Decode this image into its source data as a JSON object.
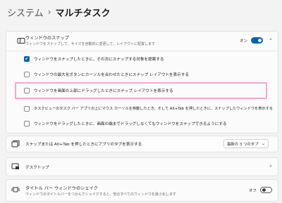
{
  "breadcrumb": {
    "root": "システム",
    "separator": "›",
    "current": "マルチタスク"
  },
  "snap": {
    "title": "ウィンドウのスナップ",
    "subtitle": "ウィンドウをスナップして、サイズを自動的に変更して、レイアウトに配置します",
    "toggle_state": "オン",
    "toggle_on": true,
    "options": [
      {
        "label": "ウィンドウをスナップしたときに、その次にスナップする対象を提案する",
        "checked": true
      },
      {
        "label": "ウィンドウの最大化ボタンにカーソルを合わせたときにスナップ レイアウトを表示する",
        "checked": false
      },
      {
        "label": "ウィンドウを画面の上部にドラッグしたときにスナップ レイアウトを表示する",
        "checked": false
      },
      {
        "label": "タスクビューのタスク バー アプリの上にマウス カーソルを移動したとき、そして Alt+Tab を押したときに、スナップしたウィンドウを表示する",
        "checked": false
      },
      {
        "label": "ウィンドウをドラッグしたときに、画面の端までドラッグしなくてもウィンドウをスナップできるようにする",
        "checked": false
      }
    ]
  },
  "alttab": {
    "title": "スナップまたは Alt+Tab を押したときにアプリのタブを表示する",
    "dropdown_value": "最新の 3 つのタブ"
  },
  "desktop": {
    "title": "デスクトップ"
  },
  "shake": {
    "title": "タイトル バー ウィンドウのシェイク",
    "subtitle": "ウィンドウのタイトルバーをつかんでシェイクすると、他のすべてのウィンドウを最小化します",
    "toggle_state": "オフ",
    "toggle_on": false
  },
  "colors": {
    "accent": "#005fb8",
    "highlight": "#f2a9c9"
  }
}
